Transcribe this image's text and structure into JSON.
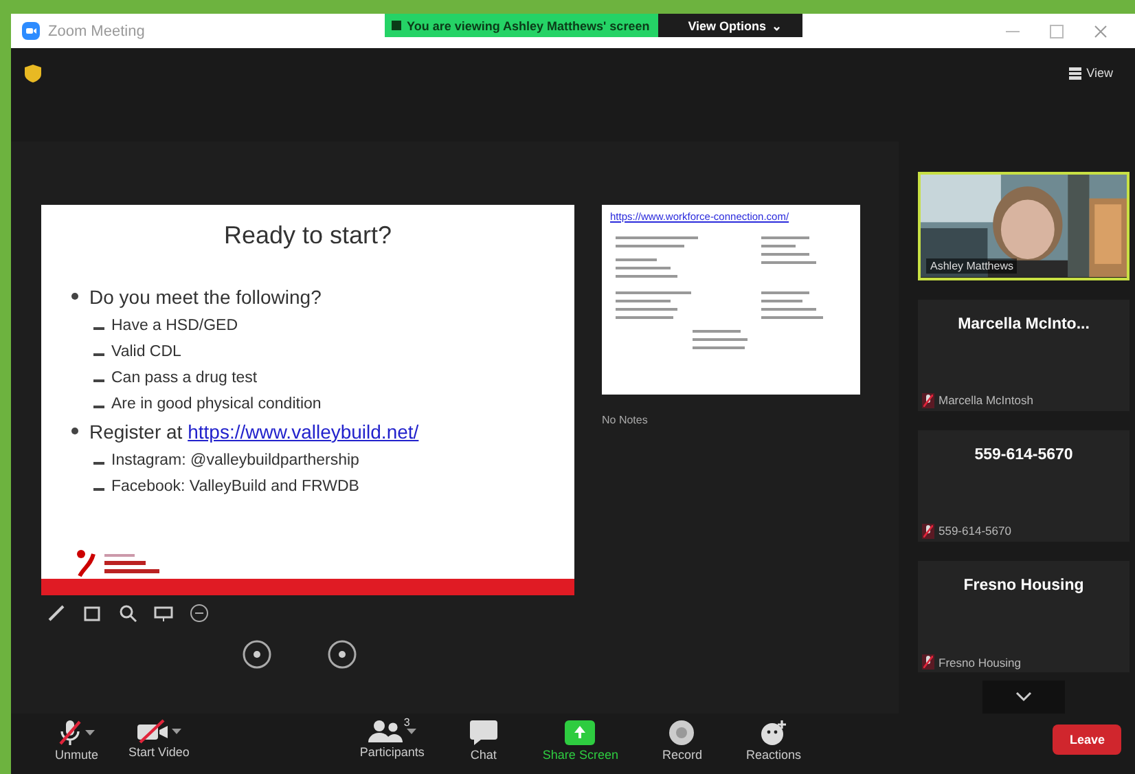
{
  "window": {
    "title": "Zoom Meeting"
  },
  "share_banner": {
    "text": "You are viewing Ashley Matthews' screen",
    "options_button": "View Options",
    "options_caret": "⌄"
  },
  "view_button": {
    "label": "View"
  },
  "slide": {
    "title": "Ready to start?",
    "bullets": [
      {
        "text": "Do you meet the following?",
        "children": [
          "Have a HSD/GED",
          "Valid CDL",
          "Can pass a drug test",
          "Are in good physical condition"
        ]
      },
      {
        "text": "Register at",
        "link": "https://www.valleybuild.net/",
        "children": [
          "Instagram: @valleybuildparthership",
          "Facebook: ValleyBuild and FRWDB"
        ]
      }
    ]
  },
  "next_slide": {
    "link": "https://www.workforce-connection.com/"
  },
  "notes": {
    "text": "No Notes"
  },
  "participants": [
    {
      "kind": "video",
      "name": "Ashley Matthews",
      "speaking": true
    },
    {
      "kind": "tile",
      "display_name": "Marcella McInto...",
      "name": "Marcella McIntosh",
      "muted": true
    },
    {
      "kind": "tile",
      "display_name": "559-614-5670",
      "name": "559-614-5670",
      "muted": true
    },
    {
      "kind": "tile",
      "display_name": "Fresno Housing",
      "name": "Fresno Housing",
      "muted": true
    }
  ],
  "toolbar": [
    {
      "kind": "mic",
      "label": "Unmute",
      "off": true,
      "caret": true
    },
    {
      "kind": "video",
      "label": "Start Video",
      "off": true,
      "caret": true
    },
    {
      "kind": "participants",
      "label": "Participants",
      "count": "3",
      "caret": true
    },
    {
      "kind": "chat",
      "label": "Chat"
    },
    {
      "kind": "share",
      "label": "Share Screen"
    },
    {
      "kind": "record",
      "label": "Record"
    },
    {
      "kind": "reactions",
      "label": "Reactions"
    }
  ],
  "leave_button": {
    "label": "Leave"
  }
}
